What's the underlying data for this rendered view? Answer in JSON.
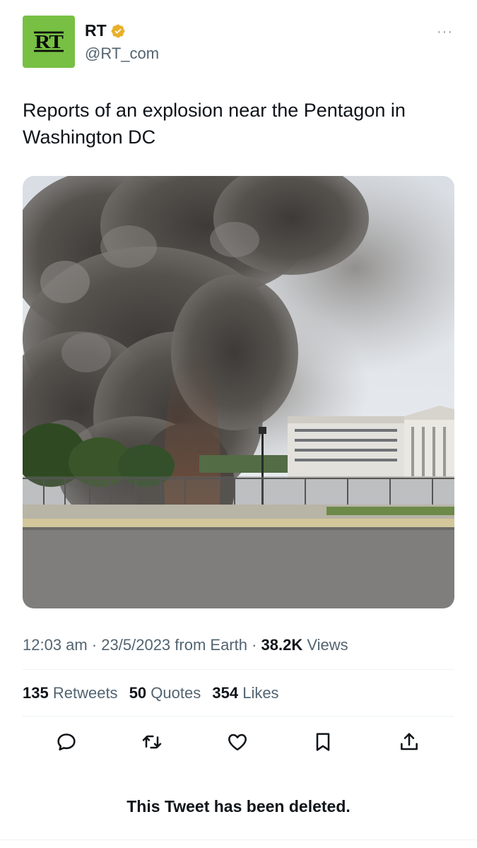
{
  "account": {
    "avatar_text": "RT",
    "display_name": "RT",
    "handle": "@RT_com",
    "avatar_color": "#77c043",
    "verified_color": "#e8b029"
  },
  "more_icon": "···",
  "tweet": {
    "text": "Reports of an explosion near the Pentagon in Washington DC"
  },
  "meta": {
    "time": "12:03 am",
    "sep1": " · ",
    "date": "23/5/2023",
    "source": " from Earth",
    "sep2": " · ",
    "views_count": "38.2K",
    "views_label": " Views"
  },
  "stats": {
    "retweets_count": "135",
    "retweets_label": "Retweets",
    "quotes_count": "50",
    "quotes_label": "Quotes",
    "likes_count": "354",
    "likes_label": "Likes"
  },
  "actions": [
    "reply-icon",
    "retweet-icon",
    "like-icon",
    "bookmark-icon",
    "share-icon"
  ],
  "deleted_notice": "This Tweet has been deleted.",
  "colors": {
    "text": "#0f1419",
    "secondary": "#536471",
    "divider": "#eff3f4"
  }
}
